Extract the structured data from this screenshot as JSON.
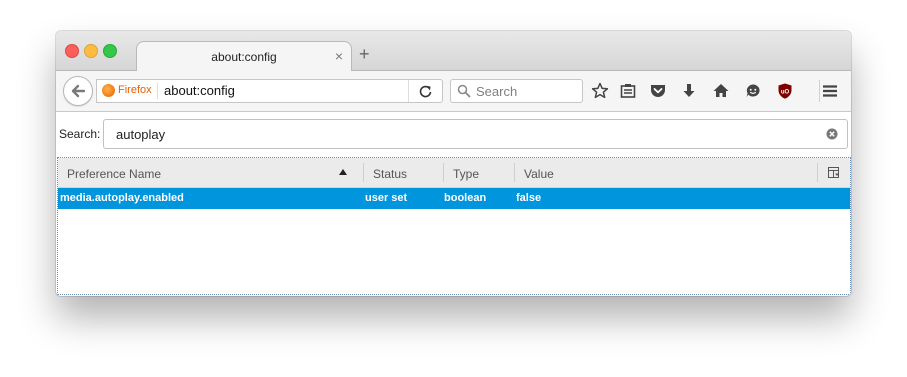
{
  "window": {
    "controls": [
      "close",
      "minimize",
      "zoom"
    ]
  },
  "tab": {
    "title": "about:config",
    "close_icon": "×",
    "new_tab_icon": "+"
  },
  "navbar": {
    "identity_label": "Firefox",
    "url": "about:config",
    "search_placeholder": "Search",
    "icons": [
      "back-icon",
      "reload-icon",
      "search-icon",
      "bookmark-star-icon",
      "reading-list-icon",
      "pocket-icon",
      "download-icon",
      "home-icon",
      "hello-icon",
      "ublock-icon",
      "menu-icon"
    ]
  },
  "config": {
    "search_label": "Search:",
    "search_value": "autoplay",
    "columns": [
      "Preference Name",
      "Status",
      "Type",
      "Value"
    ],
    "sorted_column": "Preference Name",
    "rows": [
      {
        "name": "media.autoplay.enabled",
        "status": "user set",
        "type": "boolean",
        "value": "false"
      }
    ]
  },
  "colors": {
    "selection": "#0095dd",
    "firefox_orange": "#e66000",
    "ublock_red": "#800000"
  }
}
